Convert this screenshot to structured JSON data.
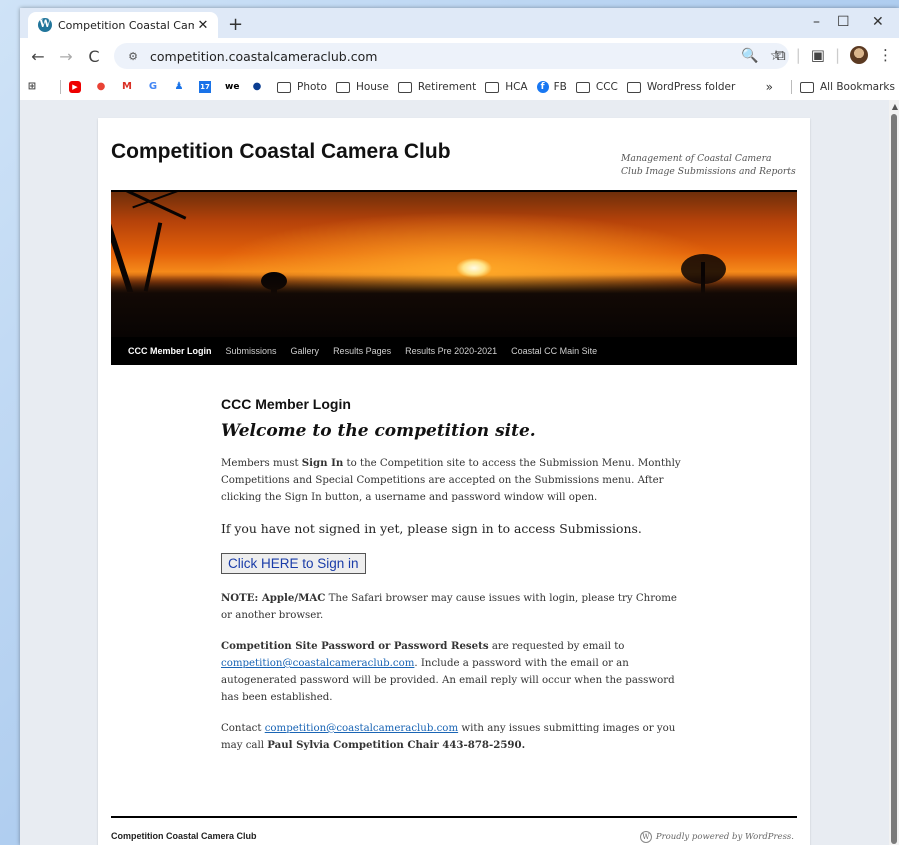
{
  "browser": {
    "tab_title": "Competition Coastal Camera Cl",
    "tab_favicon": "wordpress-icon",
    "url": "competition.coastalcameraclub.com",
    "bookmarks": [
      "Photo",
      "House",
      "Retirement",
      "HCA",
      "FB",
      "CCC",
      "WordPress folder"
    ],
    "overflow": "»",
    "all_bookmarks": "All Bookmarks"
  },
  "site": {
    "title": "Competition Coastal Camera Club",
    "description": "Management of Coastal Camera Club Image Submissions and Reports",
    "menu": [
      "CCC Member Login",
      "Submissions",
      "Gallery",
      "Results Pages",
      "Results Pre 2020-2021",
      "Coastal CC Main Site"
    ]
  },
  "content": {
    "heading": "CCC Member Login",
    "welcome": "Welcome to the competition site.",
    "p1_a": "Members must ",
    "p1_bold": "Sign In",
    "p1_b": " to the Competition site to access the Submission Menu. Monthly Competitions and Special Competitions are accepted on the Submissions menu. After clicking the Sign In button, a username and password window will open.",
    "p2": "If you have not signed in yet, please sign in to access Submissions.",
    "signin_button": "Click HERE to Sign in",
    "note_bold": "NOTE: Apple/MAC",
    "note_text": " The Safari browser may cause issues with login, please try Chrome or another browser.",
    "pw_bold": "Competition Site Password or Password Resets",
    "pw_a": " are requested by email to ",
    "email": "competition@coastalcameraclub.com",
    "pw_b": ". Include a password with the email or an autogenerated password will be provided. An email reply will occur when the password has been established.",
    "contact_a": "Contact ",
    "contact_b": " with any issues submitting images or you may call ",
    "contact_bold": "Paul Sylvia Competition Chair 443-878-2590."
  },
  "footer": {
    "left": "Competition Coastal Camera Club",
    "right": "Proudly powered by WordPress."
  }
}
